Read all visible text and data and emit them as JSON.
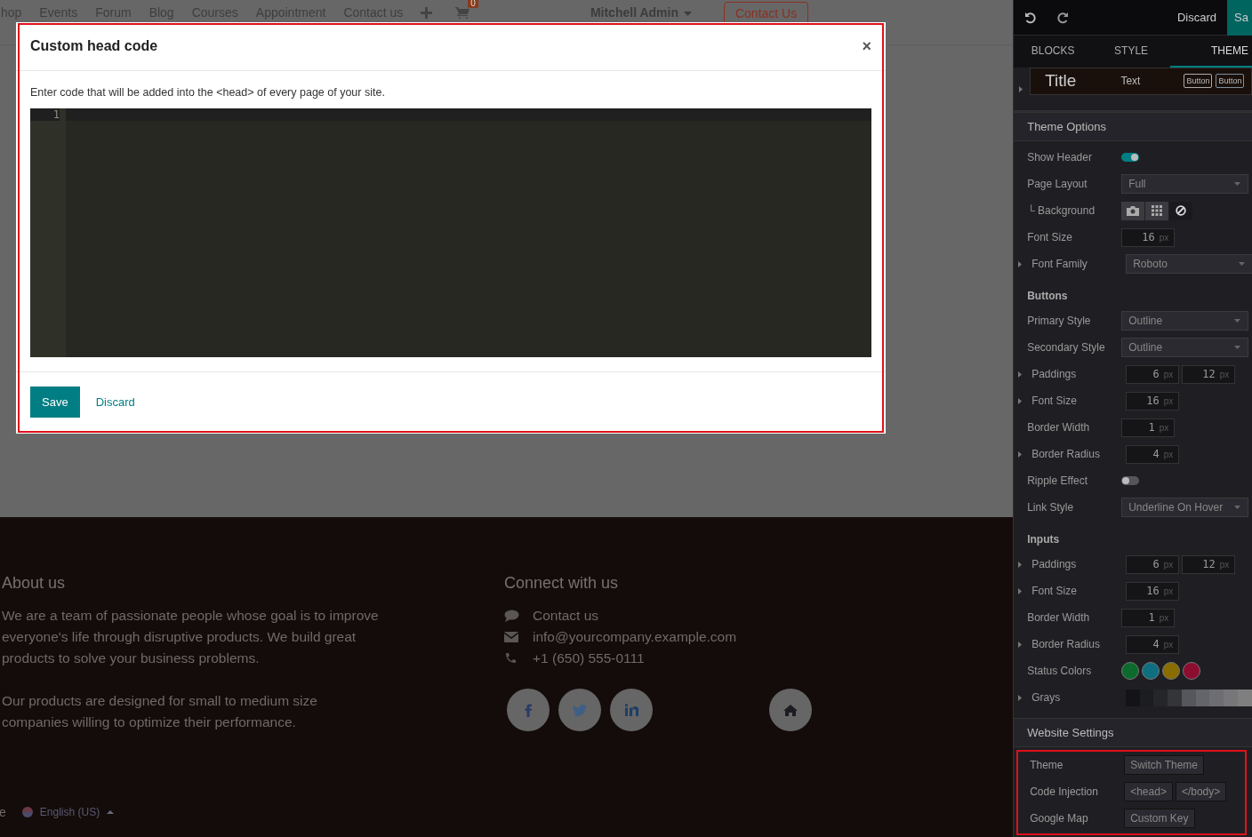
{
  "site_nav": {
    "items": [
      "hop",
      "Events",
      "Forum",
      "Blog",
      "Courses",
      "Appointment",
      "Contact us"
    ],
    "cart_count": "0",
    "user": "Mitchell Admin",
    "cta": "Contact Us"
  },
  "modal": {
    "highlighted": true,
    "title": "Custom head code",
    "close": "×",
    "description": "Enter code that will be added into the <head> of every page of your site.",
    "line_numbers": [
      "1"
    ],
    "save": "Save",
    "discard": "Discard"
  },
  "footer": {
    "about": {
      "heading": "About us",
      "paragraphs": [
        [
          "We are a team of passionate people whose goal is to improve",
          "everyone's life through disruptive products. We build great",
          "products to solve your business problems."
        ],
        [
          "Our products are designed for small to medium size",
          "companies willing to optimize their performance."
        ]
      ]
    },
    "connect": {
      "heading": "Connect with us",
      "items": [
        {
          "kind": "chat",
          "text": "Contact us"
        },
        {
          "kind": "email",
          "text": "info@yourcompany.example.com"
        },
        {
          "kind": "phone",
          "text": "+1 (650) 555-0111"
        }
      ],
      "social": [
        {
          "kind": "facebook"
        },
        {
          "kind": "twitter"
        },
        {
          "kind": "linkedin"
        },
        {
          "kind": "home"
        }
      ]
    },
    "bottom": {
      "fragment": "e",
      "language": "English (US)"
    }
  },
  "editor": {
    "toolbar": {
      "discard": "Discard",
      "save": "Sa"
    },
    "tabs": [
      {
        "label": "BLOCKS",
        "selected": false
      },
      {
        "label": "STYLE",
        "selected": false
      },
      {
        "label": "THEME",
        "selected": true
      }
    ],
    "preview": {
      "title": "Title",
      "text": "Text",
      "buttons": [
        "Button",
        "Button"
      ]
    },
    "sections": [
      {
        "title": "Theme Options",
        "highlighted": false,
        "rows": [
          {
            "kind": "toggle",
            "label": "Show Header",
            "expandable": false,
            "on": true
          },
          {
            "kind": "select",
            "label": "Page Layout",
            "expandable": false,
            "value": "Full"
          },
          {
            "kind": "icons",
            "label": "└ Background",
            "expandable": false,
            "options": [
              {
                "selected": false
              },
              {
                "selected": false
              },
              {
                "selected": true
              }
            ]
          },
          {
            "kind": "number",
            "label": "Font Size",
            "expandable": false,
            "values": [
              {
                "value": "16",
                "unit": "px"
              }
            ]
          },
          {
            "kind": "select",
            "label": "Font Family",
            "expandable": true,
            "value": "Roboto"
          },
          {
            "kind": "subheading",
            "label": "Buttons"
          },
          {
            "kind": "select",
            "label": "Primary Style",
            "expandable": false,
            "value": "Outline"
          },
          {
            "kind": "select",
            "label": "Secondary Style",
            "expandable": false,
            "value": "Outline"
          },
          {
            "kind": "number",
            "label": "Paddings",
            "expandable": true,
            "values": [
              {
                "value": "6",
                "unit": "px"
              },
              {
                "value": "12",
                "unit": "px"
              }
            ]
          },
          {
            "kind": "number",
            "label": "Font Size",
            "expandable": true,
            "values": [
              {
                "value": "16",
                "unit": "px"
              }
            ]
          },
          {
            "kind": "number",
            "label": "Border Width",
            "expandable": false,
            "values": [
              {
                "value": "1",
                "unit": "px"
              }
            ]
          },
          {
            "kind": "number",
            "label": "Border Radius",
            "expandable": true,
            "values": [
              {
                "value": "4",
                "unit": "px"
              }
            ]
          },
          {
            "kind": "toggle",
            "label": "Ripple Effect",
            "expandable": false,
            "on": false
          },
          {
            "kind": "select",
            "label": "Link Style",
            "expandable": false,
            "value": "Underline On Hover"
          },
          {
            "kind": "subheading",
            "label": "Inputs"
          },
          {
            "kind": "number",
            "label": "Paddings",
            "expandable": true,
            "values": [
              {
                "value": "6",
                "unit": "px"
              },
              {
                "value": "12",
                "unit": "px"
              }
            ]
          },
          {
            "kind": "number",
            "label": "Font Size",
            "expandable": true,
            "values": [
              {
                "value": "16",
                "unit": "px"
              }
            ]
          },
          {
            "kind": "number",
            "label": "Border Width",
            "expandable": false,
            "values": [
              {
                "value": "1",
                "unit": "px"
              }
            ]
          },
          {
            "kind": "number",
            "label": "Border Radius",
            "expandable": true,
            "values": [
              {
                "value": "4",
                "unit": "px"
              }
            ]
          },
          {
            "kind": "colors",
            "label": "Status Colors",
            "expandable": false,
            "colors": [
              {
                "color": "#0c6b2c"
              },
              {
                "color": "#0f6f80"
              },
              {
                "color": "#8a6d00"
              },
              {
                "color": "#8d0d30"
              }
            ]
          },
          {
            "kind": "grays",
            "label": "Grays",
            "expandable": true
          }
        ]
      },
      {
        "title": "Website Settings",
        "highlighted": true,
        "rows": [
          {
            "kind": "buttons",
            "label": "Theme",
            "expandable": false,
            "buttons": [
              "Switch Theme"
            ]
          },
          {
            "kind": "buttons",
            "label": "Code Injection",
            "expandable": false,
            "buttons": [
              "<head>",
              "</body>"
            ]
          },
          {
            "kind": "buttons",
            "label": "Google Map",
            "expandable": false,
            "buttons": [
              "Custom Key"
            ]
          }
        ]
      }
    ]
  }
}
